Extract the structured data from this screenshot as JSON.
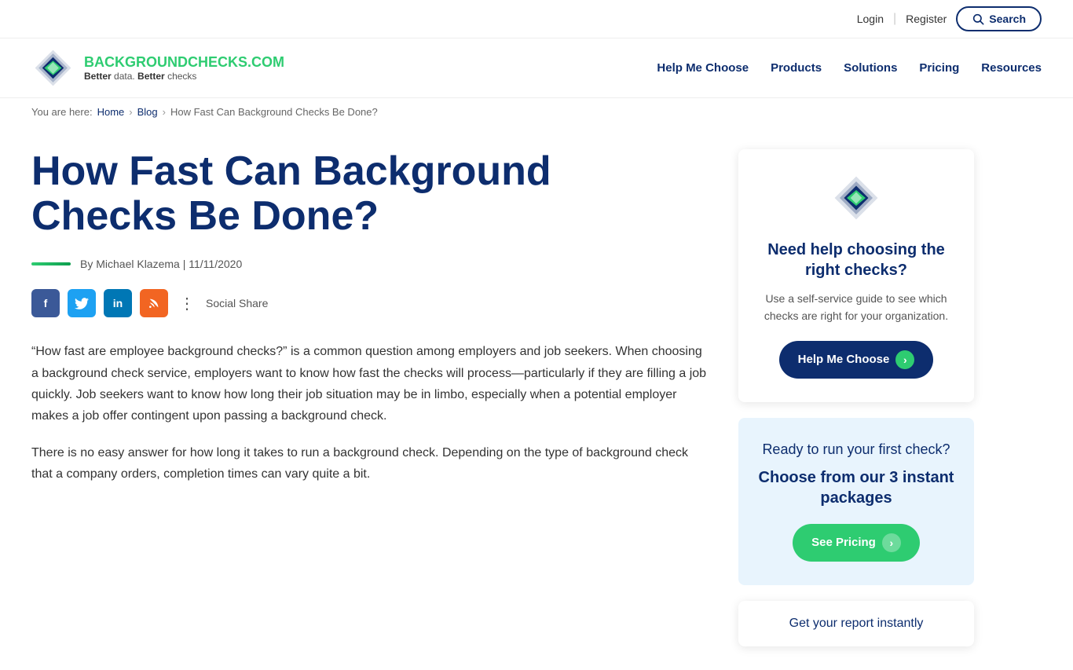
{
  "topbar": {
    "login_label": "Login",
    "register_label": "Register",
    "search_label": "Search"
  },
  "logo": {
    "brand_part1": "BACKGROUND",
    "brand_part2": "CHECKS.COM",
    "tagline_better1": "Better",
    "tagline_data": " data. ",
    "tagline_better2": "Better",
    "tagline_checks": " checks"
  },
  "nav": {
    "items": [
      {
        "label": "Help Me Choose",
        "id": "help-me-choose"
      },
      {
        "label": "Products",
        "id": "products"
      },
      {
        "label": "Solutions",
        "id": "solutions"
      },
      {
        "label": "Pricing",
        "id": "pricing"
      },
      {
        "label": "Resources",
        "id": "resources"
      }
    ]
  },
  "breadcrumb": {
    "prefix": "You are here:",
    "home": "Home",
    "blog": "Blog",
    "current": "How Fast Can Background Checks Be Done?"
  },
  "article": {
    "title": "How Fast Can Background Checks Be Done?",
    "meta_author": "By Michael Klazema | 11/11/2020",
    "body_p1": "“How fast are employee background checks?” is a common question among employers and job seekers. When choosing a background check service, employers want to know how fast the checks will process—particularly if they are filling a job quickly. Job seekers want to know how long their job situation may be in limbo, especially when a potential employer makes a job offer contingent upon passing a background check.",
    "body_p2": "There is no easy answer for how long it takes to run a background check. Depending on the type of background check that a company orders, completion times can vary quite a bit."
  },
  "social": {
    "label": "Social Share"
  },
  "sidebar": {
    "card1": {
      "heading": "Need help choosing the right checks?",
      "body": "Use a self-service guide to see which checks are right for your organization.",
      "button_label": "Help Me Choose"
    },
    "card2": {
      "ready_text": "Ready to run your first check?",
      "heading": "Choose from our 3 instant packages",
      "button_label": "See Pricing"
    },
    "card3": {
      "text": "Get your report instantly"
    }
  }
}
